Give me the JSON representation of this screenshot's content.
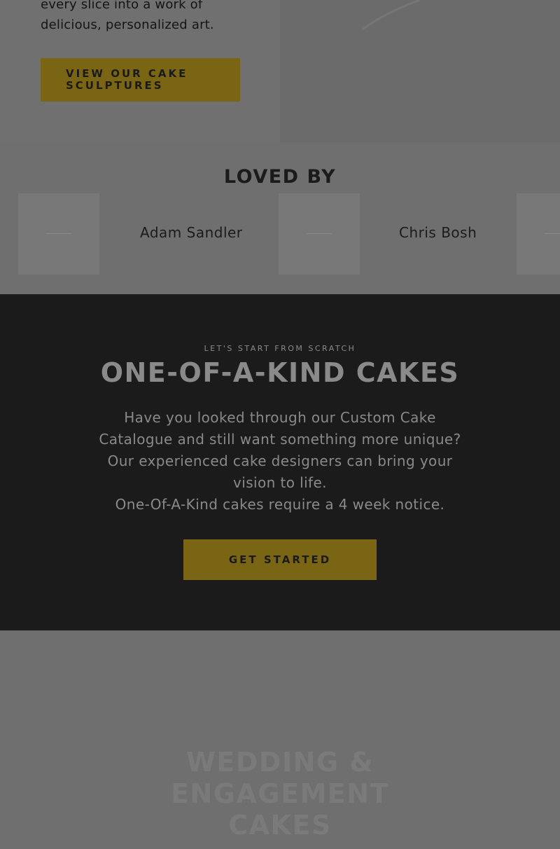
{
  "hero": {
    "copy_line_1": "every slice into a work of",
    "copy_line_2": "delicious, personalized art.",
    "cta_line_1": "VIEW OUR CAKE",
    "cta_line_2": "SCULPTURES"
  },
  "loved_by": {
    "title": "LOVED BY",
    "celebrities": [
      {
        "name": "Adam Sandler"
      },
      {
        "name": "Chris Bosh"
      }
    ]
  },
  "one_of_a_kind": {
    "eyebrow": "LET'S START FROM SCRATCH",
    "title": "ONE-OF-A-KIND CAKES",
    "body_1": "Have you looked through our Custom Cake Catalogue and still want something more unique? Our experienced cake designers can bring your vision to life.",
    "body_2": "One-Of-A-Kind cakes require a 4 week notice.",
    "cta": "GET STARTED"
  },
  "wedding": {
    "title": "WEDDING & ENGAGEMENT CAKES"
  },
  "colors": {
    "gold_accent": "#7a6514",
    "dark_section": "#1b1b1b",
    "overlay_gray": "#6f6f6f"
  }
}
